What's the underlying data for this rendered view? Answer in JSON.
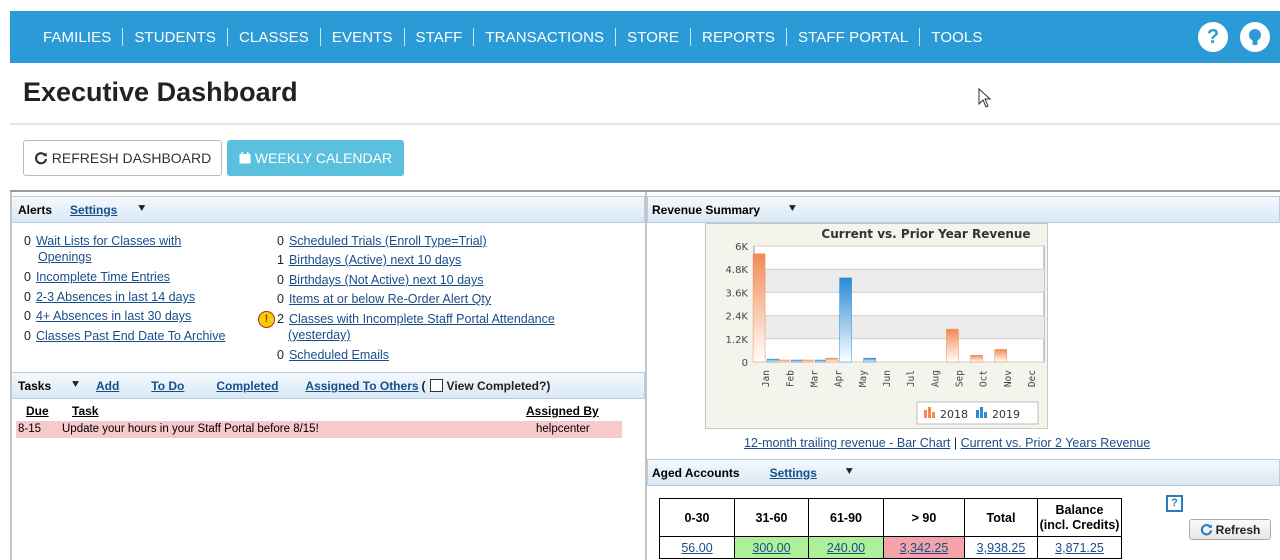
{
  "nav": {
    "items": [
      "FAMILIES",
      "STUDENTS",
      "CLASSES",
      "EVENTS",
      "STAFF",
      "TRANSACTIONS",
      "STORE",
      "REPORTS",
      "STAFF PORTAL",
      "TOOLS"
    ],
    "help_icon": "question-icon",
    "tips_icon": "lightbulb-icon"
  },
  "page": {
    "title": "Executive Dashboard"
  },
  "toolbar": {
    "refresh_label": "REFRESH DASHBOARD",
    "weekly_label": "WEEKLY CALENDAR"
  },
  "alerts": {
    "title": "Alerts",
    "settings_label": "Settings",
    "col1": [
      {
        "count": "0",
        "text": "Wait Lists for Classes with",
        "text2": "Openings"
      },
      {
        "count": "0",
        "text": "Incomplete Time Entries"
      },
      {
        "count": "0",
        "text": "2-3 Absences in last 14 days"
      },
      {
        "count": "0",
        "text": "4+ Absences in last 30 days"
      },
      {
        "count": "0",
        "text": "Classes Past End Date To Archive"
      }
    ],
    "col2": [
      {
        "count": "0",
        "text": "Scheduled Trials (Enroll Type=Trial)"
      },
      {
        "count": "1",
        "text": "Birthdays (Active) next 10 days"
      },
      {
        "count": "0",
        "text": "Birthdays (Not Active) next 10 days"
      },
      {
        "count": "0",
        "text": "Items at or below Re-Order Alert Qty"
      },
      {
        "count": "2",
        "text": "Classes with Incomplete Staff Portal Attendance",
        "text2": "(yesterday)"
      },
      {
        "count": "0",
        "text": "Scheduled Emails"
      }
    ]
  },
  "tasks": {
    "title": "Tasks",
    "add_label": "Add",
    "todo_label": "To Do",
    "completed_label": "Completed",
    "assigned_label": "Assigned To Others",
    "view_completed_label": "View Completed?)",
    "view_completed_prefix": "(",
    "columns": {
      "due": "Due",
      "task": "Task",
      "assigned_by": "Assigned By"
    },
    "rows": [
      {
        "due": "8-15",
        "task": "Update your hours in your Staff Portal before 8/15!",
        "assigned_by": "helpcenter"
      }
    ]
  },
  "revenue": {
    "panel_title": "Revenue Summary",
    "link_bar": "12-month trailing revenue - Bar Chart",
    "link_sep": "|",
    "link_prior": "Current vs. Prior 2 Years Revenue"
  },
  "chart_data": {
    "type": "bar",
    "title": "Current vs. Prior Year Revenue",
    "categories": [
      "Jan",
      "Feb",
      "Mar",
      "Apr",
      "May",
      "Jun",
      "Jul",
      "Aug",
      "Sep",
      "Oct",
      "Nov",
      "Dec"
    ],
    "series": [
      {
        "name": "2018",
        "color": "#f28a55",
        "values": [
          5600,
          60,
          40,
          200,
          0,
          0,
          0,
          0,
          1700,
          350,
          650,
          0
        ]
      },
      {
        "name": "2019",
        "color": "#2b8ad3",
        "values": [
          150,
          100,
          100,
          4350,
          200,
          0,
          0,
          0,
          0,
          0,
          0,
          0
        ]
      }
    ],
    "yticks": [
      "0",
      "1.2K",
      "2.4K",
      "3.6K",
      "4.8K",
      "6K"
    ],
    "ylim": [
      0,
      6000
    ],
    "legend_position": "bottom",
    "grid": true
  },
  "aged": {
    "panel_title": "Aged Accounts",
    "settings_label": "Settings",
    "headers": [
      "0-30",
      "31-60",
      "61-90",
      "> 90",
      "Total",
      "Balance",
      "(incl. Credits)"
    ],
    "values": [
      "56.00",
      "300.00",
      "240.00",
      "3,342.25",
      "3,938.25",
      "3,871.25"
    ],
    "cell_colors": [
      "#ffffff",
      "#aef09a",
      "#aef09a",
      "#f4a3a8",
      "#ffffff",
      "#ffffff"
    ],
    "help_label": "?",
    "refresh_label": "Refresh"
  }
}
